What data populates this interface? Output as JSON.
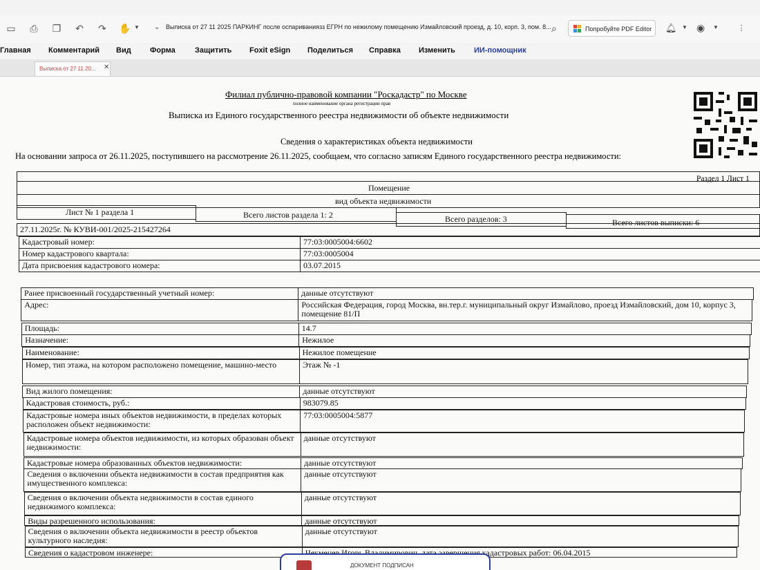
{
  "toolbar": {
    "doc_title": "Выписка от 27 11 2025 ПАРКИНГ после оспариваниязз ЕГРН по нежилому помещению Измайловский проезд, д. 10, корп. 3, пом. 8...",
    "try_button": "Попробуйте PDF Editor"
  },
  "menu": {
    "items": [
      "Главная",
      "Комментарий",
      "Вид",
      "Форма",
      "Защитить",
      "Foxit eSign",
      "Поделиться",
      "Справка",
      "Изменить",
      "ИИ-помощник"
    ]
  },
  "tabs": [
    {
      "label": "Выписка от 27 11 20..."
    }
  ],
  "document": {
    "org": "Филиал публично-правовой компании \"Роскадастр\" по Москве",
    "org_sub": "полное наименование органа регистрации прав",
    "extract_title": "Выписка из Единого государственного реестра недвижимости об объекте недвижимости",
    "info_title": "Сведения о характеристиках объекта недвижимости",
    "basis": "На основании запроса от 26.11.2025, поступившего на рассмотрение 26.11.2025, сообщаем, что согласно записям Единого государственного реестра недвижимости:",
    "section_tag": "Раздел 1 Лист 1",
    "object_type": "Помещение",
    "object_type_sub": "вид объекта недвижимости",
    "sheet_row": {
      "sheet": "Лист № 1 раздела 1",
      "total_section": "Всего листов раздела 1: 2",
      "total_sections": "Всего разделов: 3",
      "total_sheets": "Всего листов выписки: 6"
    },
    "ref": "27.11.2025г. № КУВИ-001/2025-215427264",
    "rows_top": [
      {
        "label": "Кадастровый номер:",
        "value": "77:03:0005004:6602"
      },
      {
        "label": "Номер кадастрового квартала:",
        "value": "77:03:0005004"
      },
      {
        "label": "Дата присвоения кадастрового номера:",
        "value": "03.07.2015"
      }
    ],
    "rows": [
      {
        "label": "Ранее присвоенный государственный учетный номер:",
        "value": "данные отсутствуют"
      },
      {
        "label": "Адрес:",
        "value": "Российская Федерация, город Москва, вн.тер.г. муниципальный округ Измайлово, проезд Измайловский, дом 10, корпус 3, помещение 81/П"
      },
      {
        "label": "Площадь:",
        "value": "14.7"
      },
      {
        "label": "Назначение:",
        "value": "Нежилое"
      },
      {
        "label": "Наименование:",
        "value": "Нежилое помещение"
      },
      {
        "label": "Номер, тип этажа, на котором расположено помещение, машино-место",
        "value": "Этаж № -1"
      },
      {
        "label": "Вид жилого помещения:",
        "value": "данные отсутствуют"
      },
      {
        "label": "Кадастровая стоимость, руб.:",
        "value": "983079.85"
      },
      {
        "label": "Кадастровые номера иных объектов недвижимости, в пределах которых расположен объект недвижимости:",
        "value": "77:03:0005004:5877"
      },
      {
        "label": "Кадастровые номера объектов недвижимости, из которых образован объект недвижимости:",
        "value": "данные отсутствуют"
      },
      {
        "label": "Кадастровые номера образованных объектов недвижимости:",
        "value": "данные отсутствуют"
      },
      {
        "label": "Сведения о включении объекта недвижимости в состав предприятия как имущественного комплекса:",
        "value": "данные отсутствуют"
      },
      {
        "label": "Сведения о включении объекта недвижимости в состав единого недвижимого комплекса:",
        "value": "данные отсутствуют"
      },
      {
        "label": "Виды разрешенного использования:",
        "value": "данные отсутствуют"
      },
      {
        "label": "Сведения о включении объекта недвижимости в реестр объектов культурного наследия:",
        "value": "данные отсутствуют"
      },
      {
        "label": "Сведения о кадастровом инженере:",
        "value": "Чекменев Игорь Владимирович, дата завершения кадастровых работ: 06.04.2015"
      }
    ],
    "signed_label": "ДОКУМЕНТ ПОДПИСАН"
  }
}
